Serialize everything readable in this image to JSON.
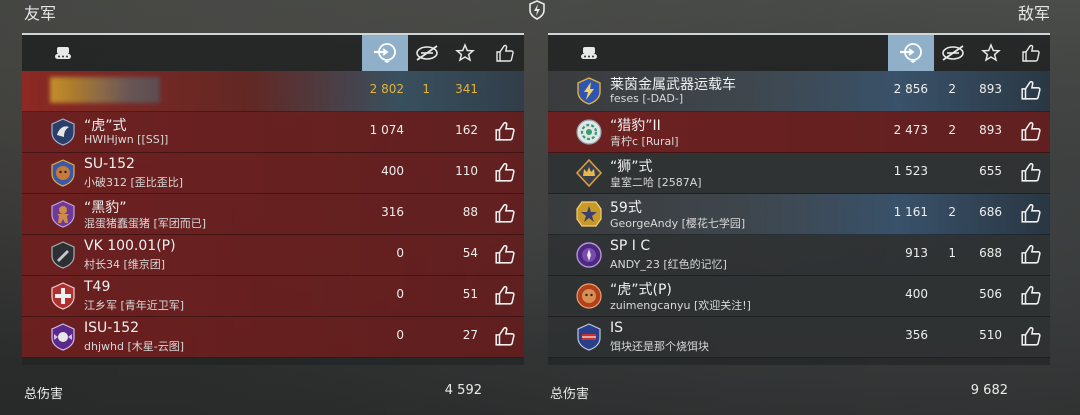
{
  "teams": {
    "ally_title": "友军",
    "enemy_title": "敌军"
  },
  "icons": {
    "center_logo": "lightning-shield-icon",
    "tank": "tank-icon",
    "damage": "damage-gauge-icon",
    "crossed": "crossed-icon",
    "star": "star-icon",
    "like": "thumbs-up-icon"
  },
  "colors": {
    "gold": "#e2b33a",
    "active_header": "#8fb0c8",
    "ally_row": "#7a1e1e",
    "neutral_row": "#323436"
  },
  "ally": {
    "rows": [
      {
        "name": "",
        "clan": "",
        "damage": "2 802",
        "kills": "1",
        "xp": "341",
        "style": "hl",
        "badge": "blurred"
      },
      {
        "name": "“虎”式",
        "clan": "HWIHjwn [[SS]]",
        "damage": "1 074",
        "kills": "",
        "xp": "162",
        "style": "red",
        "badge": "eagle-badge-icon"
      },
      {
        "name": "SU-152",
        "clan": "小破312 [歪比歪比]",
        "damage": "400",
        "kills": "",
        "xp": "110",
        "style": "red",
        "badge": "monkey-badge-icon"
      },
      {
        "name": "“黑豹”",
        "clan": "混蛋猪蠢蛋猪 [军团而已]",
        "damage": "316",
        "kills": "",
        "xp": "88",
        "style": "red",
        "badge": "gingerbread-badge-icon"
      },
      {
        "name": "VK 100.01(P)",
        "clan": "村长34 [维京团]",
        "damage": "0",
        "kills": "",
        "xp": "54",
        "style": "red",
        "badge": "shell-badge-icon"
      },
      {
        "name": "T49",
        "clan": "江乡军 [青年近卫军]",
        "damage": "0",
        "kills": "",
        "xp": "51",
        "style": "red",
        "badge": "cross-badge-icon"
      },
      {
        "name": "ISU-152",
        "clan": "dhjwhd [木星-云图]",
        "damage": "0",
        "kills": "",
        "xp": "27",
        "style": "red",
        "badge": "wing-badge-icon"
      }
    ],
    "total_label": "总伤害",
    "total_value": "4 592"
  },
  "enemy": {
    "rows": [
      {
        "name": "莱茵金属武器运载车",
        "clan": "feses [-DAD-]",
        "damage": "2 856",
        "kills": "2",
        "xp": "893",
        "style": "blue-hl",
        "badge": "bolt-badge-icon"
      },
      {
        "name": "“猎豹”II",
        "clan": "青柠c [Rural]",
        "damage": "2 473",
        "kills": "2",
        "xp": "893",
        "style": "red",
        "badge": "wreath-badge-icon"
      },
      {
        "name": "“狮”式",
        "clan": "皇室二哈 [2587A]",
        "damage": "1 523",
        "kills": "",
        "xp": "655",
        "style": "gray",
        "badge": "crown-badge-icon"
      },
      {
        "name": "59式",
        "clan": "GeorgeAndy [樱花七学园]",
        "damage": "1 161",
        "kills": "2",
        "xp": "686",
        "style": "blue-hl",
        "badge": "star-badge-icon"
      },
      {
        "name": "SP I C",
        "clan": "ANDY_23 [红色的记忆]",
        "damage": "913",
        "kills": "1",
        "xp": "688",
        "style": "gray",
        "badge": "knight-badge-icon"
      },
      {
        "name": "“虎”式(P)",
        "clan": "zuimengcanyu [欢迎关注!]",
        "damage": "400",
        "kills": "",
        "xp": "506",
        "style": "gray",
        "badge": "monkey-badge-icon"
      },
      {
        "name": "IS",
        "clan": "饵块还是那个烧饵块",
        "damage": "356",
        "kills": "",
        "xp": "510",
        "style": "gray",
        "badge": "flag-badge-icon"
      }
    ],
    "total_label": "总伤害",
    "total_value": "9 682"
  }
}
